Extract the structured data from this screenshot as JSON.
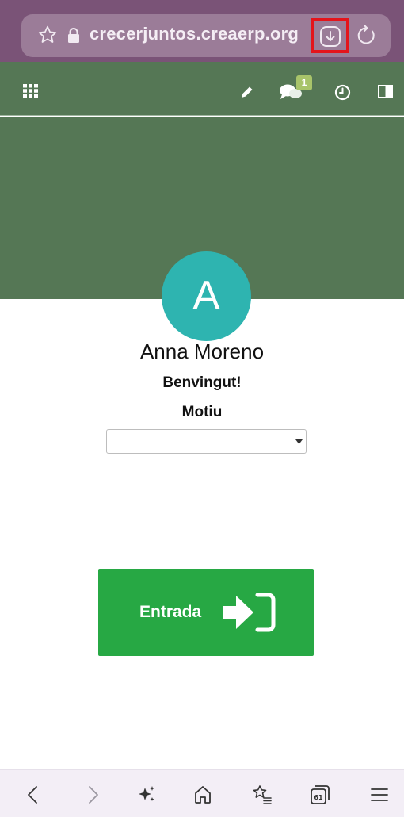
{
  "browser": {
    "url": "crecerjuntos.creaerp.org",
    "accent": "#7a5377",
    "highlight_color": "#e4141b"
  },
  "toolbar": {
    "icons": [
      "apps-grid-icon",
      "pencil-icon",
      "chat-icon",
      "clock-icon",
      "panel-icon"
    ],
    "chat_badge": "1",
    "background": "#557755"
  },
  "profile": {
    "initial": "A",
    "name": "Anna Moreno",
    "avatar_color": "#2eb4b0"
  },
  "main": {
    "welcome": "Benvingut!",
    "reason_label": "Motiu",
    "reason_selected": "",
    "entry_button_label": "Entrada",
    "entry_button_color": "#27a844"
  },
  "bottom_nav": {
    "tab_count": "61",
    "icons": [
      "back-icon",
      "forward-icon",
      "sparkle-icon",
      "home-icon",
      "bookmarks-icon",
      "tabs-icon",
      "menu-icon"
    ]
  }
}
